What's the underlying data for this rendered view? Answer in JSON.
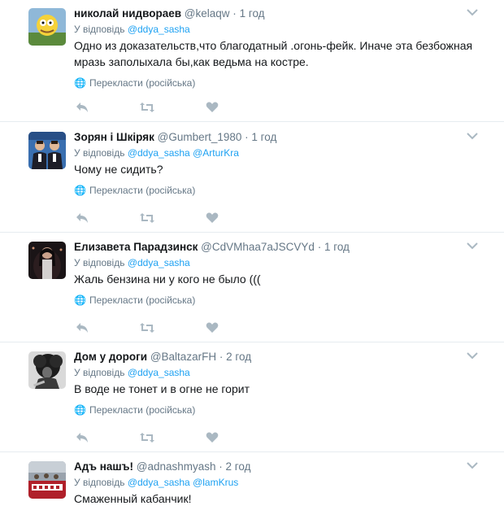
{
  "tweets": [
    {
      "name": "николай нидвораев",
      "handle": "@kelaqw",
      "separator": "·",
      "time": "1 год",
      "reply_prefix": "У відповідь",
      "mentions": [
        "@ddya_sasha"
      ],
      "text": "Одно из доказательств,что благодатный .огонь-фейк. Иначе эта безбожная мразь заполыхала бы,как ведьма на костре.",
      "translate": "Перекласти (російська)"
    },
    {
      "name": "Зорян і Шкіряк",
      "handle": "@Gumbert_1980",
      "separator": "·",
      "time": "1 год",
      "reply_prefix": "У відповідь",
      "mentions": [
        "@ddya_sasha",
        "@ArturKra"
      ],
      "text": "Чому не сидить?",
      "translate": "Перекласти (російська)"
    },
    {
      "name": "Елизавета Парадзинск",
      "handle": "@CdVMhaa7aJSCVYd",
      "separator": "·",
      "time": "1 год",
      "reply_prefix": "У відповідь",
      "mentions": [
        "@ddya_sasha"
      ],
      "text": "Жаль бензина ни у кого не было (((",
      "translate": "Перекласти (російська)"
    },
    {
      "name": "Дом у дороги",
      "handle": "@BaltazarFH",
      "separator": "·",
      "time": "2 год",
      "reply_prefix": "У відповідь",
      "mentions": [
        "@ddya_sasha"
      ],
      "text": "В воде не тонет и в огне не горит",
      "translate": "Перекласти (російська)"
    },
    {
      "name": "Адъ нашъ!",
      "handle": "@adnashmyash",
      "separator": "·",
      "time": "2 год",
      "reply_prefix": "У відповідь",
      "mentions": [
        "@ddya_sasha",
        "@lamKrus"
      ],
      "text": "Смаженный кабанчик!",
      "translate": ""
    }
  ],
  "icons": {
    "reply": "reply-icon",
    "retweet": "retweet-icon",
    "like": "heart-icon",
    "globe": "globe-icon",
    "caret": "chevron-down-icon"
  },
  "colors": {
    "link": "#1da1f2",
    "muted": "#657786",
    "action": "#aab8c2",
    "border": "#e6ecf0"
  }
}
